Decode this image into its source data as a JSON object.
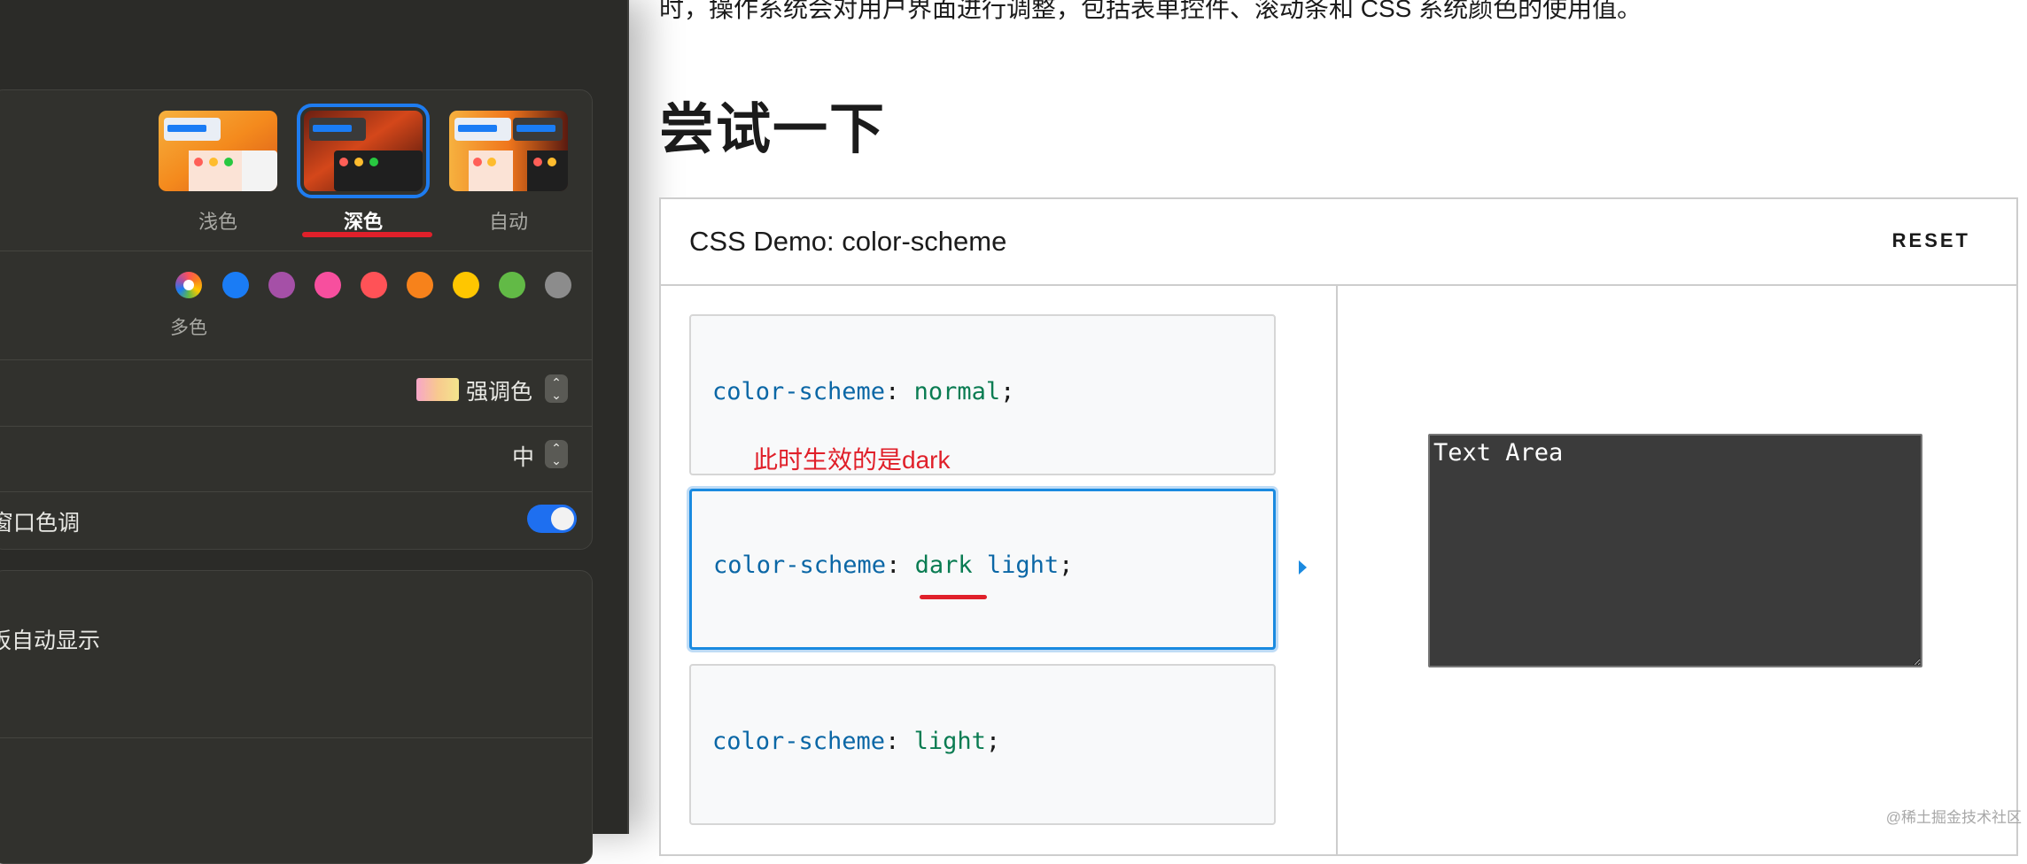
{
  "settings": {
    "appearance": {
      "options": [
        {
          "label": "浅色",
          "selected": false
        },
        {
          "label": "深色",
          "selected": true
        },
        {
          "label": "自动",
          "selected": false
        }
      ]
    },
    "accent": {
      "colors": [
        "#multicolor",
        "#1a7cf5",
        "#a550a7",
        "#f74f9e",
        "#ff5257",
        "#f7821b",
        "#ffc600",
        "#62ba46",
        "#8c8c8c"
      ],
      "selected_label": "多色"
    },
    "highlight": {
      "value": "强调色"
    },
    "sidebar_icon_size": {
      "value": "中"
    },
    "wallpaper_tint": {
      "label": "窗口色调",
      "on": true
    },
    "scrollbars": {
      "label": "板自动显示"
    }
  },
  "page": {
    "intro": "时，操作系统会对用户界面进行调整，包括表单控件、滚动条和 CSS 系统颜色的使用值。",
    "heading": "尝试一下"
  },
  "demo": {
    "title": "CSS Demo: color-scheme",
    "reset_label": "RESET",
    "examples": [
      {
        "property": "color-scheme",
        "value": "normal",
        "note": "此时生效的是dark"
      },
      {
        "property": "color-scheme",
        "value1": "dark",
        "value2": "light"
      },
      {
        "property": "color-scheme",
        "value": "light"
      }
    ],
    "output": {
      "textarea_value": "Text Area"
    }
  },
  "watermark": "@稀土掘金技术社区",
  "colors": {
    "accent_blue": "#1a8ae0",
    "annotation_red": "#e0202a",
    "panel_dark": "#2b2b28"
  }
}
